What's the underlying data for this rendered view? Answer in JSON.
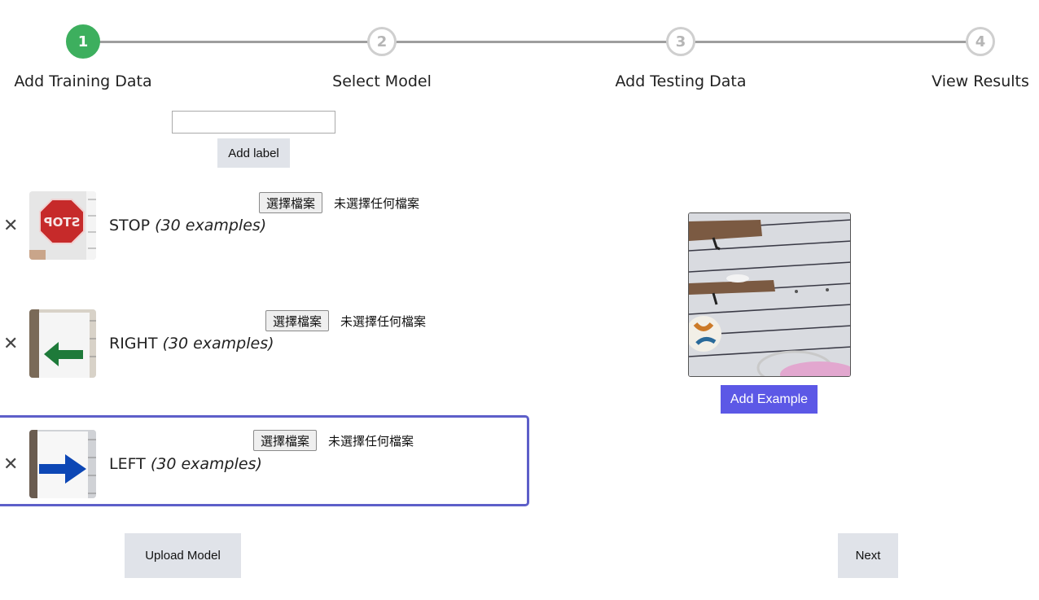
{
  "stepper": {
    "steps": [
      {
        "number": "1",
        "label": "Add Training Data",
        "state": "active"
      },
      {
        "number": "2",
        "label": "Select Model",
        "state": "inactive"
      },
      {
        "number": "3",
        "label": "Add Testing Data",
        "state": "inactive"
      },
      {
        "number": "4",
        "label": "View Results",
        "state": "inactive"
      }
    ],
    "active_color": "#3daf5e"
  },
  "label_form": {
    "input_value": "",
    "add_label_button": "Add label"
  },
  "classes": [
    {
      "name": "STOP",
      "examples": "(30 examples)",
      "file_button": "選擇檔案",
      "file_status": "未選擇任何檔案",
      "thumb_icon": "stop-sign-icon",
      "selected": false
    },
    {
      "name": "RIGHT",
      "examples": "(30 examples)",
      "file_button": "選擇檔案",
      "file_status": "未選擇任何檔案",
      "thumb_icon": "left-arrow-icon",
      "selected": false
    },
    {
      "name": "LEFT",
      "examples": "(30 examples)",
      "file_button": "選擇檔案",
      "file_status": "未選擇任何檔案",
      "thumb_icon": "right-arrow-icon",
      "selected": true
    }
  ],
  "remove_glyph": "✕",
  "webcam": {
    "add_example_button": "Add Example",
    "accent": "#5c58e6"
  },
  "footer": {
    "upload_model_button": "Upload Model",
    "next_button": "Next"
  },
  "selection_color": "#5d5fc9"
}
